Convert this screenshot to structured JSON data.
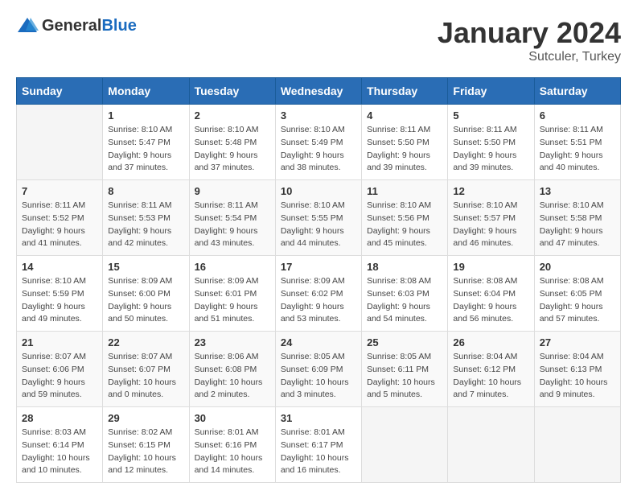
{
  "logo": {
    "text_general": "General",
    "text_blue": "Blue"
  },
  "header": {
    "title": "January 2024",
    "subtitle": "Sutculer, Turkey"
  },
  "weekdays": [
    "Sunday",
    "Monday",
    "Tuesday",
    "Wednesday",
    "Thursday",
    "Friday",
    "Saturday"
  ],
  "weeks": [
    [
      {
        "day": "",
        "info": ""
      },
      {
        "day": "1",
        "info": "Sunrise: 8:10 AM\nSunset: 5:47 PM\nDaylight: 9 hours\nand 37 minutes."
      },
      {
        "day": "2",
        "info": "Sunrise: 8:10 AM\nSunset: 5:48 PM\nDaylight: 9 hours\nand 37 minutes."
      },
      {
        "day": "3",
        "info": "Sunrise: 8:10 AM\nSunset: 5:49 PM\nDaylight: 9 hours\nand 38 minutes."
      },
      {
        "day": "4",
        "info": "Sunrise: 8:11 AM\nSunset: 5:50 PM\nDaylight: 9 hours\nand 39 minutes."
      },
      {
        "day": "5",
        "info": "Sunrise: 8:11 AM\nSunset: 5:50 PM\nDaylight: 9 hours\nand 39 minutes."
      },
      {
        "day": "6",
        "info": "Sunrise: 8:11 AM\nSunset: 5:51 PM\nDaylight: 9 hours\nand 40 minutes."
      }
    ],
    [
      {
        "day": "7",
        "info": "Sunrise: 8:11 AM\nSunset: 5:52 PM\nDaylight: 9 hours\nand 41 minutes."
      },
      {
        "day": "8",
        "info": "Sunrise: 8:11 AM\nSunset: 5:53 PM\nDaylight: 9 hours\nand 42 minutes."
      },
      {
        "day": "9",
        "info": "Sunrise: 8:11 AM\nSunset: 5:54 PM\nDaylight: 9 hours\nand 43 minutes."
      },
      {
        "day": "10",
        "info": "Sunrise: 8:10 AM\nSunset: 5:55 PM\nDaylight: 9 hours\nand 44 minutes."
      },
      {
        "day": "11",
        "info": "Sunrise: 8:10 AM\nSunset: 5:56 PM\nDaylight: 9 hours\nand 45 minutes."
      },
      {
        "day": "12",
        "info": "Sunrise: 8:10 AM\nSunset: 5:57 PM\nDaylight: 9 hours\nand 46 minutes."
      },
      {
        "day": "13",
        "info": "Sunrise: 8:10 AM\nSunset: 5:58 PM\nDaylight: 9 hours\nand 47 minutes."
      }
    ],
    [
      {
        "day": "14",
        "info": "Sunrise: 8:10 AM\nSunset: 5:59 PM\nDaylight: 9 hours\nand 49 minutes."
      },
      {
        "day": "15",
        "info": "Sunrise: 8:09 AM\nSunset: 6:00 PM\nDaylight: 9 hours\nand 50 minutes."
      },
      {
        "day": "16",
        "info": "Sunrise: 8:09 AM\nSunset: 6:01 PM\nDaylight: 9 hours\nand 51 minutes."
      },
      {
        "day": "17",
        "info": "Sunrise: 8:09 AM\nSunset: 6:02 PM\nDaylight: 9 hours\nand 53 minutes."
      },
      {
        "day": "18",
        "info": "Sunrise: 8:08 AM\nSunset: 6:03 PM\nDaylight: 9 hours\nand 54 minutes."
      },
      {
        "day": "19",
        "info": "Sunrise: 8:08 AM\nSunset: 6:04 PM\nDaylight: 9 hours\nand 56 minutes."
      },
      {
        "day": "20",
        "info": "Sunrise: 8:08 AM\nSunset: 6:05 PM\nDaylight: 9 hours\nand 57 minutes."
      }
    ],
    [
      {
        "day": "21",
        "info": "Sunrise: 8:07 AM\nSunset: 6:06 PM\nDaylight: 9 hours\nand 59 minutes."
      },
      {
        "day": "22",
        "info": "Sunrise: 8:07 AM\nSunset: 6:07 PM\nDaylight: 10 hours\nand 0 minutes."
      },
      {
        "day": "23",
        "info": "Sunrise: 8:06 AM\nSunset: 6:08 PM\nDaylight: 10 hours\nand 2 minutes."
      },
      {
        "day": "24",
        "info": "Sunrise: 8:05 AM\nSunset: 6:09 PM\nDaylight: 10 hours\nand 3 minutes."
      },
      {
        "day": "25",
        "info": "Sunrise: 8:05 AM\nSunset: 6:11 PM\nDaylight: 10 hours\nand 5 minutes."
      },
      {
        "day": "26",
        "info": "Sunrise: 8:04 AM\nSunset: 6:12 PM\nDaylight: 10 hours\nand 7 minutes."
      },
      {
        "day": "27",
        "info": "Sunrise: 8:04 AM\nSunset: 6:13 PM\nDaylight: 10 hours\nand 9 minutes."
      }
    ],
    [
      {
        "day": "28",
        "info": "Sunrise: 8:03 AM\nSunset: 6:14 PM\nDaylight: 10 hours\nand 10 minutes."
      },
      {
        "day": "29",
        "info": "Sunrise: 8:02 AM\nSunset: 6:15 PM\nDaylight: 10 hours\nand 12 minutes."
      },
      {
        "day": "30",
        "info": "Sunrise: 8:01 AM\nSunset: 6:16 PM\nDaylight: 10 hours\nand 14 minutes."
      },
      {
        "day": "31",
        "info": "Sunrise: 8:01 AM\nSunset: 6:17 PM\nDaylight: 10 hours\nand 16 minutes."
      },
      {
        "day": "",
        "info": ""
      },
      {
        "day": "",
        "info": ""
      },
      {
        "day": "",
        "info": ""
      }
    ]
  ]
}
